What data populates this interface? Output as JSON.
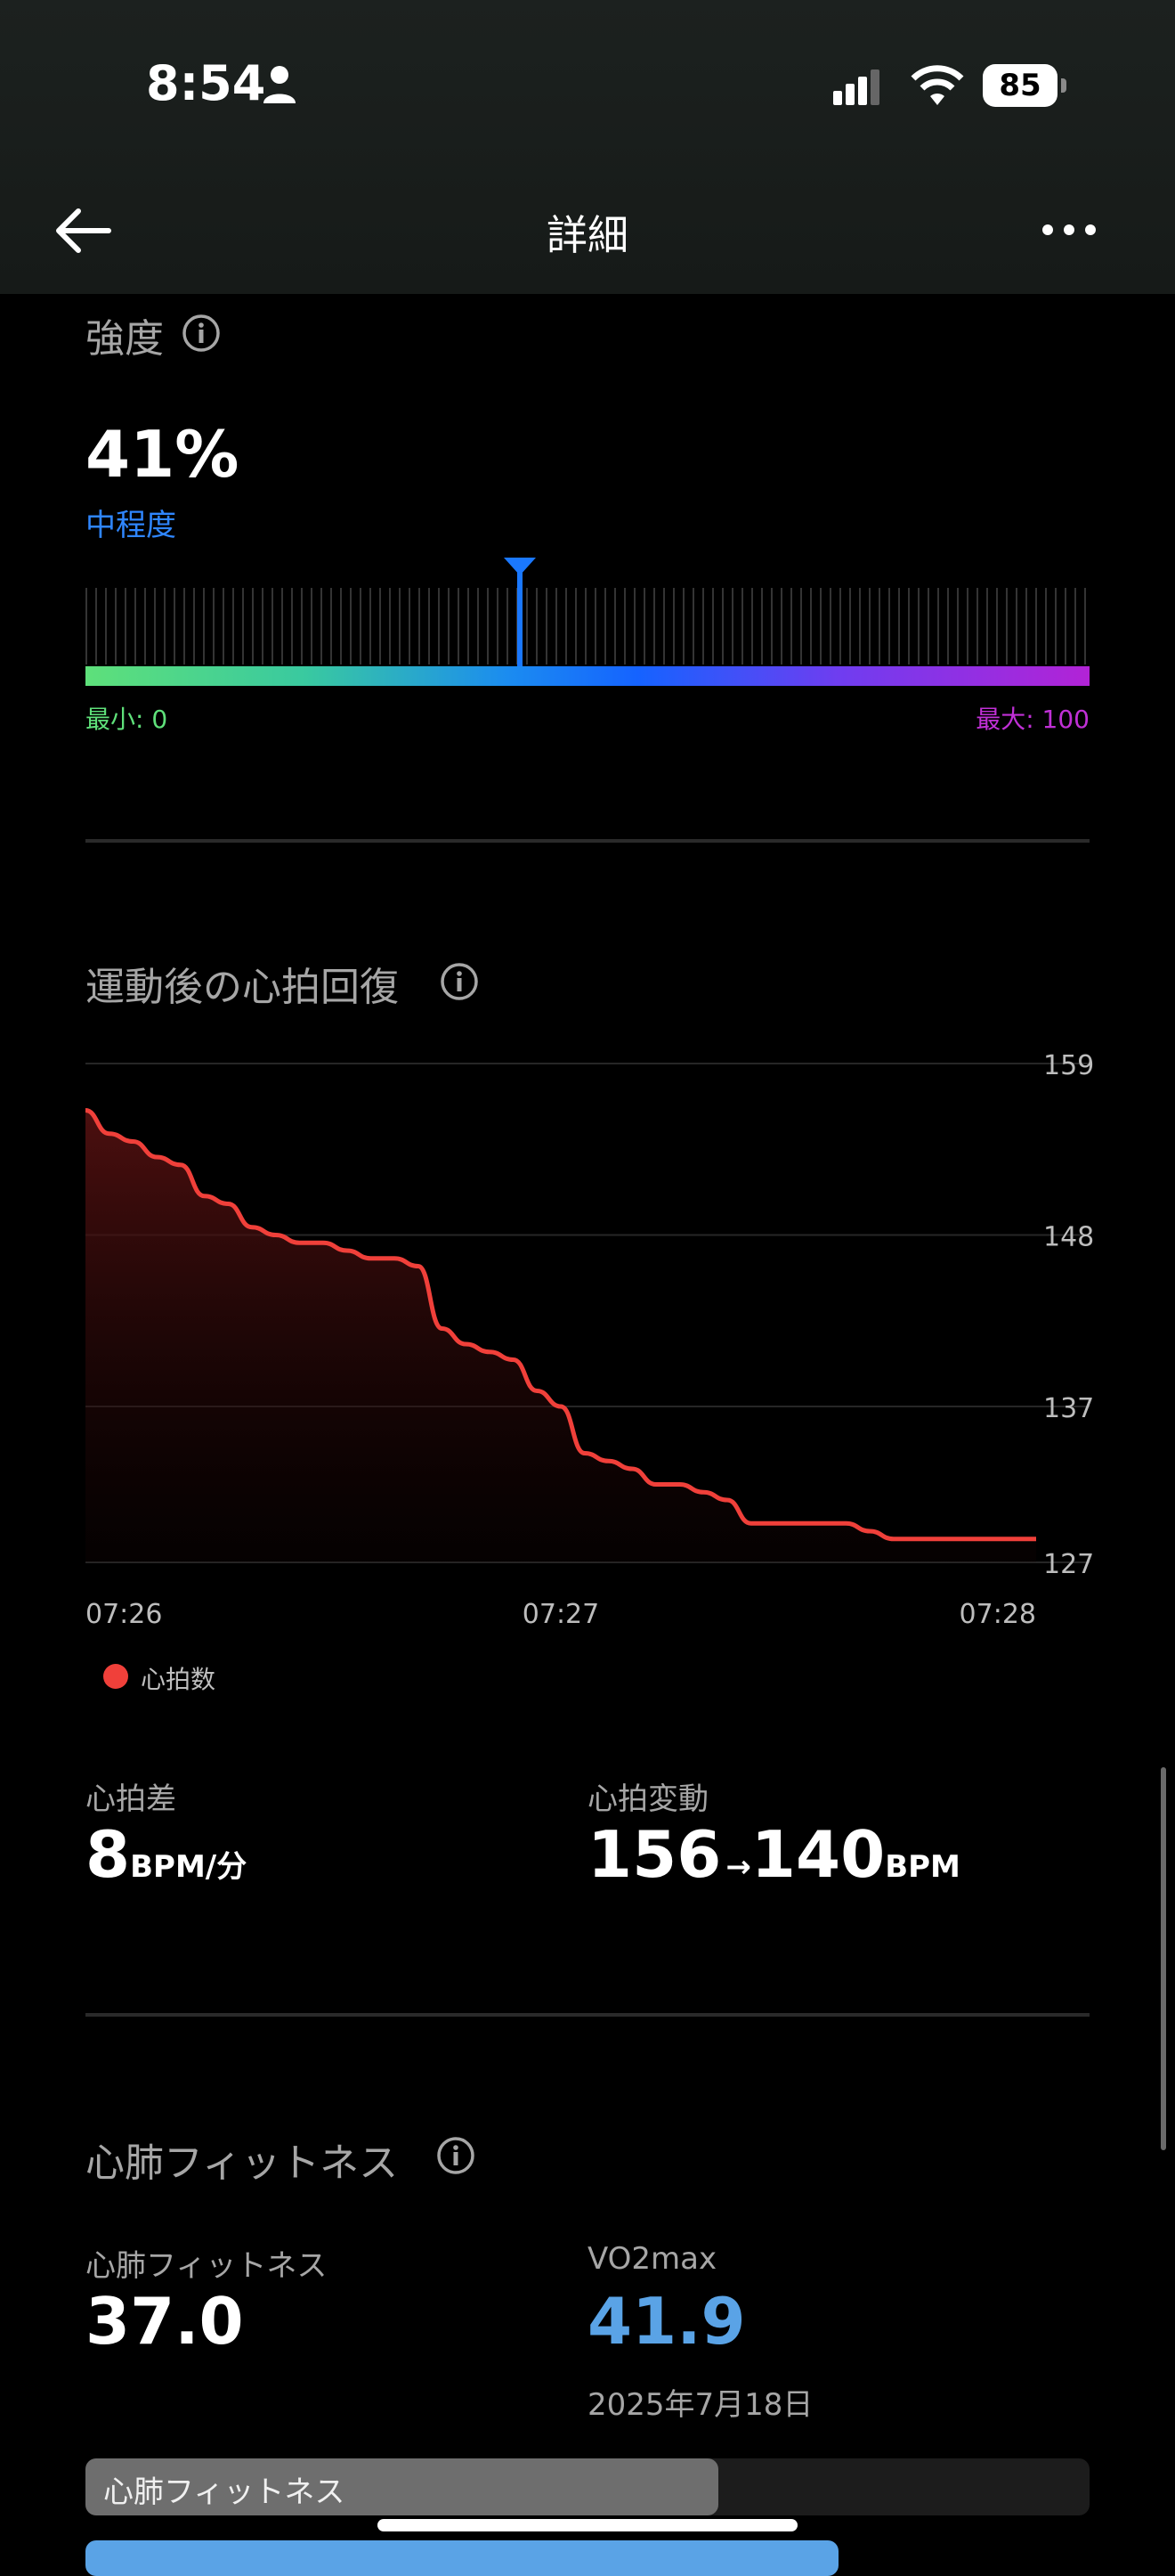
{
  "status_bar": {
    "time": "8:54",
    "battery": "85"
  },
  "header": {
    "title": "詳細"
  },
  "intensity": {
    "title": "強度",
    "value": "41%",
    "level": "中程度",
    "marker_fraction": 0.41,
    "min_label": "最小: 0",
    "max_label": "最大: 100"
  },
  "recovery": {
    "title": "運動後の心拍回復",
    "legend": "心拍数",
    "stats": {
      "diff_label": "心拍差",
      "diff_value": "8",
      "diff_unit": "BPM/分",
      "change_label": "心拍変動",
      "change_from": "156",
      "arrow": "→",
      "change_to": "140",
      "change_unit": "BPM"
    }
  },
  "chart_data": {
    "type": "line",
    "series": [
      {
        "name": "心拍数",
        "x": [
          0,
          3,
          6,
          9,
          12,
          15,
          18,
          21,
          24,
          27,
          30,
          33,
          36,
          39,
          42,
          45,
          48,
          51,
          54,
          57,
          60,
          63,
          66,
          69,
          72,
          75,
          78,
          81,
          84,
          87,
          90,
          93,
          96,
          99,
          102,
          105,
          108,
          111,
          114,
          117,
          120
        ],
        "values": [
          156,
          154.5,
          154,
          153,
          152.5,
          150.5,
          150,
          148.5,
          148,
          147.5,
          147.5,
          147,
          146.5,
          146.5,
          146,
          142,
          141,
          140.5,
          140,
          138,
          137,
          134,
          133.5,
          133,
          132,
          132,
          131.5,
          131,
          129.5,
          129.5,
          129.5,
          129.5,
          129.5,
          129,
          128.5,
          128.5,
          128.5,
          128.5,
          128.5,
          128.5,
          128.5
        ]
      }
    ],
    "x_tick_labels": [
      "07:26",
      "07:27",
      "07:28"
    ],
    "y_ticks": [
      159,
      148,
      137,
      127
    ],
    "ylim": [
      127,
      159
    ],
    "line_color": "#f0403a",
    "grid": true
  },
  "fitness": {
    "title": "心肺フィットネス",
    "fitness_label": "心肺フィットネス",
    "fitness_value": "37.0",
    "vo2_label": "VO2max",
    "vo2_value": "41.9",
    "vo2_date": "2025年7月18日",
    "bar_label": "心肺フィットネス",
    "bar_fraction": 0.63
  },
  "colors": {
    "accent_blue": "#2f86ff",
    "vo2_blue": "#5aa3e6",
    "hr_red": "#f0403a"
  }
}
